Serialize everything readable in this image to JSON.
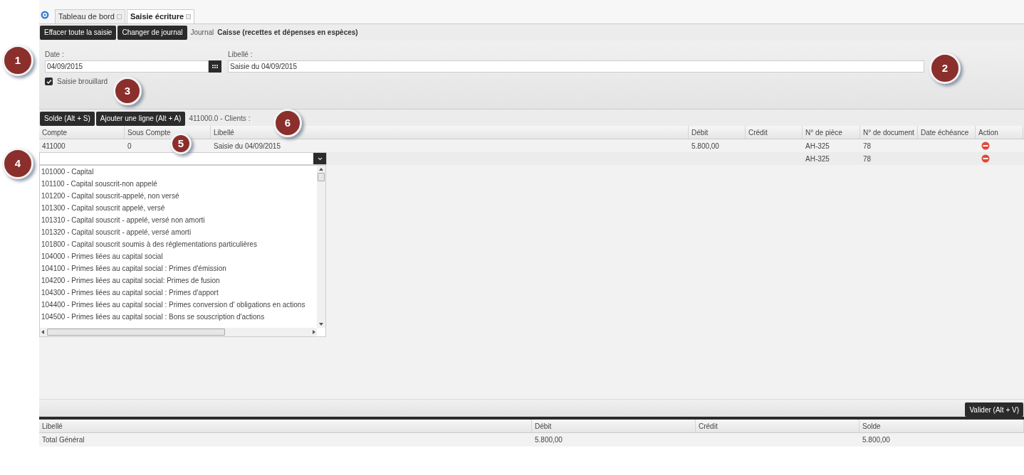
{
  "tabs": [
    {
      "label": "Tableau de bord",
      "selected": false
    },
    {
      "label": "Saisie écriture",
      "selected": true
    }
  ],
  "toolbar": {
    "buttons": [
      "Effacer toute la saisie",
      "Changer de journal"
    ],
    "journal_label": "Journal",
    "journal_name": "Caisse (recettes et dépenses en espèces)"
  },
  "form": {
    "date_label": "Date :",
    "date_value": "04/09/2015",
    "libelle_label": "Libellé :",
    "libelle_value": "Saisie du 04/09/2015",
    "brouillard_label": "Saisie brouillard",
    "brouillard_checked": true
  },
  "grid_toolbar": {
    "buttons": [
      "Solde (Alt + S)",
      "Ajouter une ligne (Alt + A)"
    ],
    "info": "411000.0 - Clients :"
  },
  "table": {
    "columns": [
      "Compte",
      "Sous Compte",
      "Libellé",
      "Débit",
      "Crédit",
      "N° de pièce",
      "N° de document",
      "Date échéance",
      "Action"
    ],
    "rows": [
      {
        "kind": "data",
        "cells": [
          "411000",
          "0",
          "Saisie du 04/09/2015",
          "5.800,00",
          "",
          "AH-325",
          "78",
          ""
        ]
      },
      {
        "kind": "edit",
        "cells": [
          "",
          "",
          "",
          "",
          "",
          "AH-325",
          "78",
          ""
        ]
      }
    ]
  },
  "dropdown": {
    "options": [
      "101000 - Capital",
      "101100 - Capital souscrit-non appelé",
      "101200 - Capital souscrit-appelé, non versé",
      "101300 - Capital souscrit appelé, versé",
      "101310 - Capital souscrit - appelé, versé non amorti",
      "101320 - Capital souscrit - appelé, versé amorti",
      "101800 - Capital souscrit soumis à des réglementations particulières",
      "104000 - Primes liées au capital social",
      "104100 - Primes liées au capital social : Primes d'émission",
      "104200 - Primes liées au capital social: Primes de fusion",
      "104300 - Primes liées au capital social : Primes d'apport",
      "104400 - Primes liées au capital social : Primes conversion d' obligations en actions",
      "104500 - Primes liées au capital social : Bons se souscription d'actions"
    ]
  },
  "validate_button": "Valider (Alt + V)",
  "summary": {
    "columns": [
      "Libellé",
      "Débit",
      "Crédit",
      "Solde"
    ],
    "rows": [
      [
        "Total Général",
        "5.800,00",
        "",
        "5.800,00"
      ]
    ]
  },
  "callouts": [
    "1",
    "2",
    "3",
    "4",
    "5",
    "6"
  ]
}
